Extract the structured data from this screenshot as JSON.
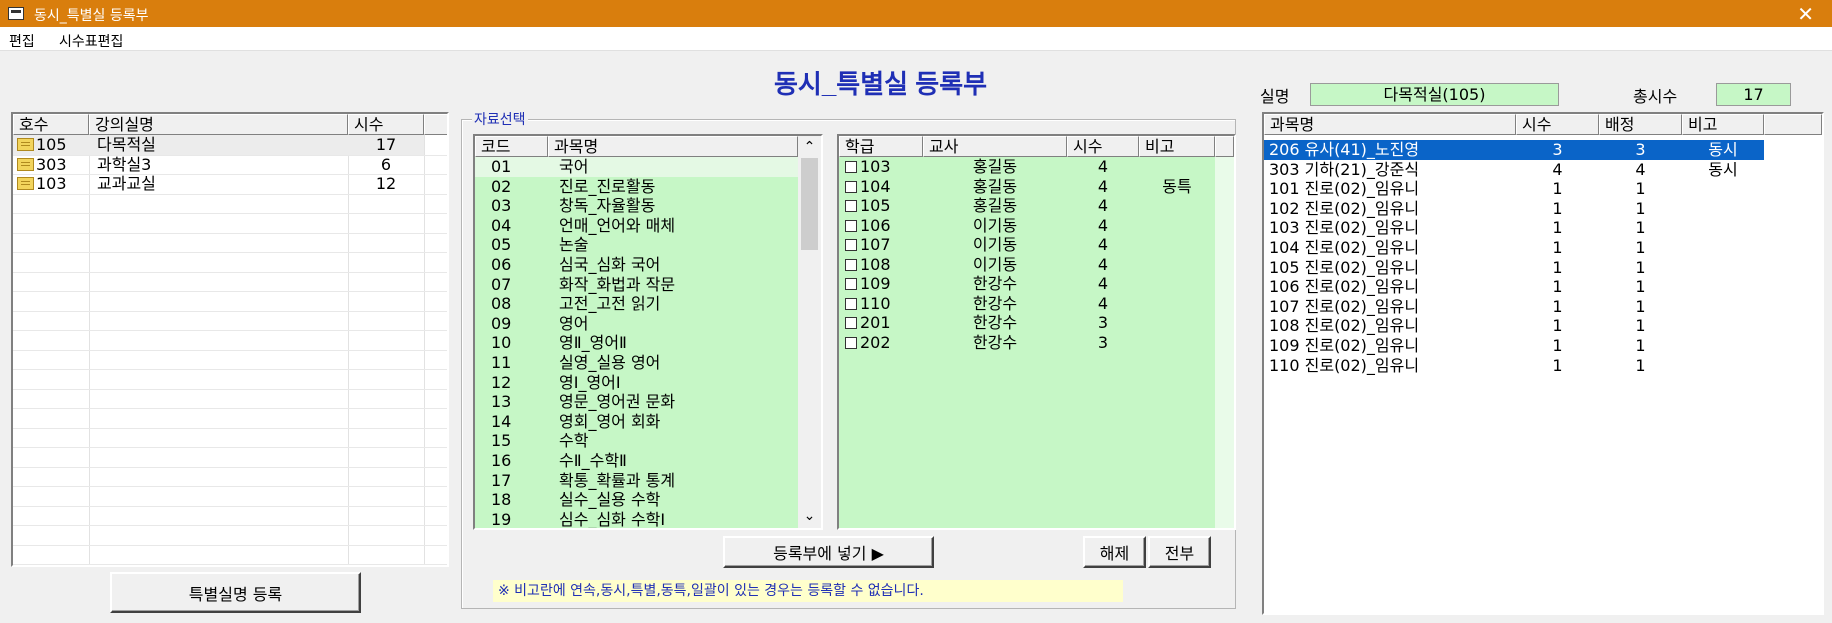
{
  "window": {
    "title": "동시_특별실 등록부",
    "close_glyph": "✕"
  },
  "menu": [
    "편집",
    "시수표편집"
  ],
  "heading": "동시_특별실 등록부",
  "room": {
    "label": "실명",
    "value": "다목적실(105)"
  },
  "total": {
    "label": "총시수",
    "value": "17"
  },
  "left_table": {
    "headers": [
      "호수",
      "강의실명",
      "시수"
    ],
    "rows": [
      {
        "no": "105",
        "name": "다목적실",
        "hours": "17"
      },
      {
        "no": "303",
        "name": "과학실3",
        "hours": "6"
      },
      {
        "no": "103",
        "name": "교과교실",
        "hours": "12"
      }
    ]
  },
  "register_room_button": "특별실명 등록",
  "group_label": "자료선택",
  "subject_table": {
    "headers": [
      "코드",
      "과목명"
    ],
    "rows": [
      {
        "code": "01",
        "name": "국어"
      },
      {
        "code": "02",
        "name": "진로_진로활동"
      },
      {
        "code": "03",
        "name": "창독_자율활동"
      },
      {
        "code": "04",
        "name": "언매_언어와 매체"
      },
      {
        "code": "05",
        "name": "논술"
      },
      {
        "code": "06",
        "name": "심국_심화 국어"
      },
      {
        "code": "07",
        "name": "화작_화법과 작문"
      },
      {
        "code": "08",
        "name": "고전_고전 읽기"
      },
      {
        "code": "09",
        "name": "영어"
      },
      {
        "code": "10",
        "name": "영Ⅱ_영어Ⅱ"
      },
      {
        "code": "11",
        "name": "실영_실용 영어"
      },
      {
        "code": "12",
        "name": "영Ⅰ_영어Ⅰ"
      },
      {
        "code": "13",
        "name": "영문_영어권 문화"
      },
      {
        "code": "14",
        "name": "영회_영어 회화"
      },
      {
        "code": "15",
        "name": "수학"
      },
      {
        "code": "16",
        "name": "수Ⅱ_수학Ⅱ"
      },
      {
        "code": "17",
        "name": "확통_확률과 통계"
      },
      {
        "code": "18",
        "name": "실수_실용 수학"
      },
      {
        "code": "19",
        "name": "심수_심화 수학Ⅰ"
      }
    ],
    "scroll_up": "⌃",
    "scroll_down": "⌄"
  },
  "class_table": {
    "headers": [
      "학급",
      "교사",
      "시수",
      "비고"
    ],
    "rows": [
      {
        "cls": "103",
        "teacher": "홍길동",
        "hours": "4",
        "note": ""
      },
      {
        "cls": "104",
        "teacher": "홍길동",
        "hours": "4",
        "note": "동특"
      },
      {
        "cls": "105",
        "teacher": "홍길동",
        "hours": "4",
        "note": ""
      },
      {
        "cls": "106",
        "teacher": "이기동",
        "hours": "4",
        "note": ""
      },
      {
        "cls": "107",
        "teacher": "이기동",
        "hours": "4",
        "note": ""
      },
      {
        "cls": "108",
        "teacher": "이기동",
        "hours": "4",
        "note": ""
      },
      {
        "cls": "109",
        "teacher": "한강수",
        "hours": "4",
        "note": ""
      },
      {
        "cls": "110",
        "teacher": "한강수",
        "hours": "4",
        "note": ""
      },
      {
        "cls": "201",
        "teacher": "한강수",
        "hours": "3",
        "note": ""
      },
      {
        "cls": "202",
        "teacher": "한강수",
        "hours": "3",
        "note": ""
      }
    ]
  },
  "add_button": "등록부에 넣기 ▶",
  "release_button": "해제",
  "all_button": "전부",
  "notice": "※ 비고란에 연속,동시,특별,동특,일괄이 있는 경우는 등록할  수 없습니다.",
  "right_table": {
    "headers": [
      "과목명",
      "시수",
      "배정",
      "비고"
    ],
    "rows": [
      {
        "name": "206 유사(41)_노진영",
        "hours": "3",
        "assigned": "3",
        "note": "동시",
        "selected": true
      },
      {
        "name": "303 기하(21)_강준식",
        "hours": "4",
        "assigned": "4",
        "note": "동시"
      },
      {
        "name": "101 진로(02)_임유니",
        "hours": "1",
        "assigned": "1",
        "note": ""
      },
      {
        "name": "102 진로(02)_임유니",
        "hours": "1",
        "assigned": "1",
        "note": ""
      },
      {
        "name": "103 진로(02)_임유니",
        "hours": "1",
        "assigned": "1",
        "note": ""
      },
      {
        "name": "104 진로(02)_임유니",
        "hours": "1",
        "assigned": "1",
        "note": ""
      },
      {
        "name": "105 진로(02)_임유니",
        "hours": "1",
        "assigned": "1",
        "note": ""
      },
      {
        "name": "106 진로(02)_임유니",
        "hours": "1",
        "assigned": "1",
        "note": ""
      },
      {
        "name": "107 진로(02)_임유니",
        "hours": "1",
        "assigned": "1",
        "note": ""
      },
      {
        "name": "108 진로(02)_임유니",
        "hours": "1",
        "assigned": "1",
        "note": ""
      },
      {
        "name": "109 진로(02)_임유니",
        "hours": "1",
        "assigned": "1",
        "note": ""
      },
      {
        "name": "110 진로(02)_임유니",
        "hours": "1",
        "assigned": "1",
        "note": ""
      }
    ]
  },
  "colors": {
    "title_bar": "#d97e0d",
    "heading": "#1f2fb5",
    "list_green": "#c6f7c6",
    "selection": "#0a64c8",
    "notice_bg": "#ffffcc"
  }
}
